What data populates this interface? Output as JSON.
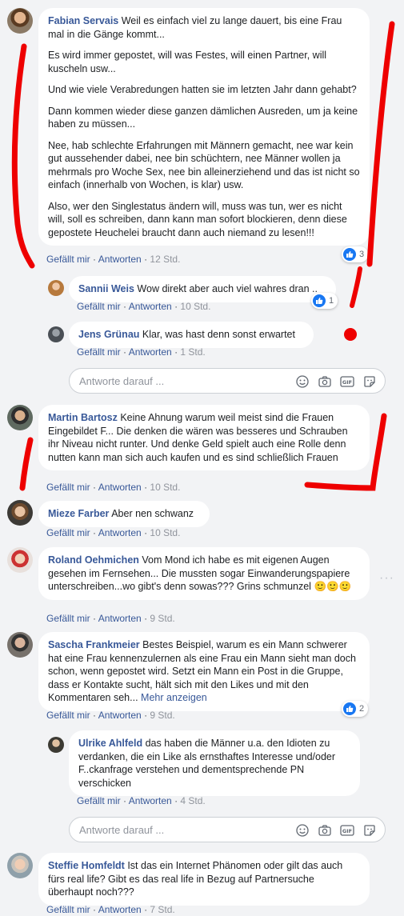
{
  "actions": {
    "like": "Gefällt mir",
    "reply": "Antworten",
    "sep": " · "
  },
  "reply_placeholder": "Antworte darauf ...",
  "comments": [
    {
      "name": "Fabian Servais",
      "paras": [
        "Weil es einfach viel zu lange dauert, bis eine Frau mal in die Gänge kommt...",
        "Es wird immer gepostet, will was Festes, will einen Partner, will kuscheln usw...",
        "Und wie viele Verabredungen hatten sie im letzten Jahr dann gehabt?",
        "Dann kommen wieder diese ganzen dämlichen Ausreden, um ja keine haben zu müssen...",
        "Nee, hab schlechte Erfahrungen mit Männern gemacht, nee war kein gut aussehender dabei, nee bin schüchtern, nee Männer wollen ja mehrmals pro Woche Sex, nee bin alleinerziehend und das ist nicht so einfach (innerhalb von Wochen, is klar) usw.",
        "Also, wer den Singlestatus ändern will, muss was tun, wer es nicht will, soll es schreiben, dann kann man sofort blockieren, denn diese gepostete Heuchelei braucht dann auch niemand zu lesen!!!"
      ],
      "time": "12 Std.",
      "likes": "3"
    },
    {
      "name": "Sannii Weis",
      "text": "Wow direkt aber auch viel wahres dran ..",
      "time": "10 Std.",
      "likes": "1"
    },
    {
      "name": "Jens Grünau",
      "text": "Klar, was hast denn sonst erwartet",
      "time": "1 Std."
    },
    {
      "name": "Martin Bartosz",
      "text": "Keine Ahnung warum weil meist sind die Frauen Eingebildet F... Die denken die wären was besseres und Schrauben ihr Niveau nicht runter. Und denke Geld spielt auch eine Rolle denn nutten kann man sich auch kaufen und es sind schließlich Frauen",
      "time": "10 Std."
    },
    {
      "name": "Mieze Farber",
      "text": "Aber nen schwanz",
      "time": "10 Std."
    },
    {
      "name": "Roland Oehmichen",
      "text": "Vom Mond ich habe es mit eigenen Augen gesehen im Fernsehen... Die mussten sogar Einwanderungspapiere unterschreiben...wo gibt's denn sowas??? Grins schmunzel",
      "emoji": "🙂🙂🙂",
      "time": "9 Std."
    },
    {
      "name": "Sascha Frankmeier",
      "text": "Bestes Beispiel, warum es ein Mann schwerer hat eine Frau kennenzulernen als eine Frau ein Mann sieht man doch schon, wenn gepostet wird. Setzt ein Mann ein Post in die Gruppe, dass er Kontakte sucht, hält sich mit den Likes und mit den Kommentaren seh...",
      "more": "Mehr anzeigen",
      "time": "9 Std.",
      "likes": "2"
    },
    {
      "name": "Ulrike Ahlfeld",
      "text": "das haben die Männer u.a. den Idioten zu verdanken, die ein Like als ernsthaftes Interesse und/oder F..ckanfrage verstehen und dementsprechende PN verschicken",
      "time": "4 Std."
    },
    {
      "name": "Steffie Homfeldt",
      "text": "Ist das ein Internet Phänomen oder gilt das auch fürs real life? Gibt es das real life in Bezug auf Partnersuche überhaupt noch???",
      "time": "7 Std."
    }
  ],
  "colors": {
    "name": "#385898",
    "like": "#1877f2",
    "marker": "#ee0000"
  }
}
